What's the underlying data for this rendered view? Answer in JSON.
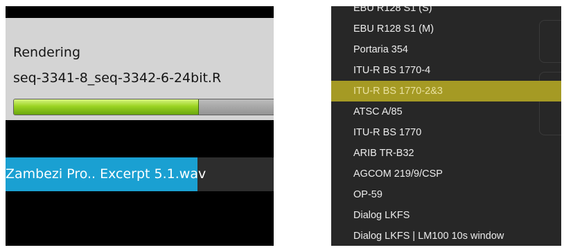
{
  "render_dialog": {
    "title": "Rendering",
    "filename": "seq-3341-8_seq-3342-6-24bit.R",
    "progress": 0.71
  },
  "file_list": {
    "selected_name": "Zambezi Pro..  Excerpt",
    "name_suffix": " 5.1.wav"
  },
  "loudness_menu": {
    "selected_index": 4,
    "items": [
      "EBU R128 S1 (S)",
      "EBU R128 S1 (M)",
      "Portaria 354",
      "ITU-R BS 1770-4",
      "ITU-R BS 1770-2&3",
      "ATSC A/85",
      "ITU-R BS 1770",
      "ARIB TR-B32",
      "AGCOM 219/9/CSP",
      "OP-59",
      "Dialog LKFS",
      "Dialog LKFS | LM100 10s window"
    ]
  },
  "colors": {
    "progress_green": "#9bd322",
    "selection_blue": "#1aa0d2",
    "menu_selection": "#a59a24"
  }
}
